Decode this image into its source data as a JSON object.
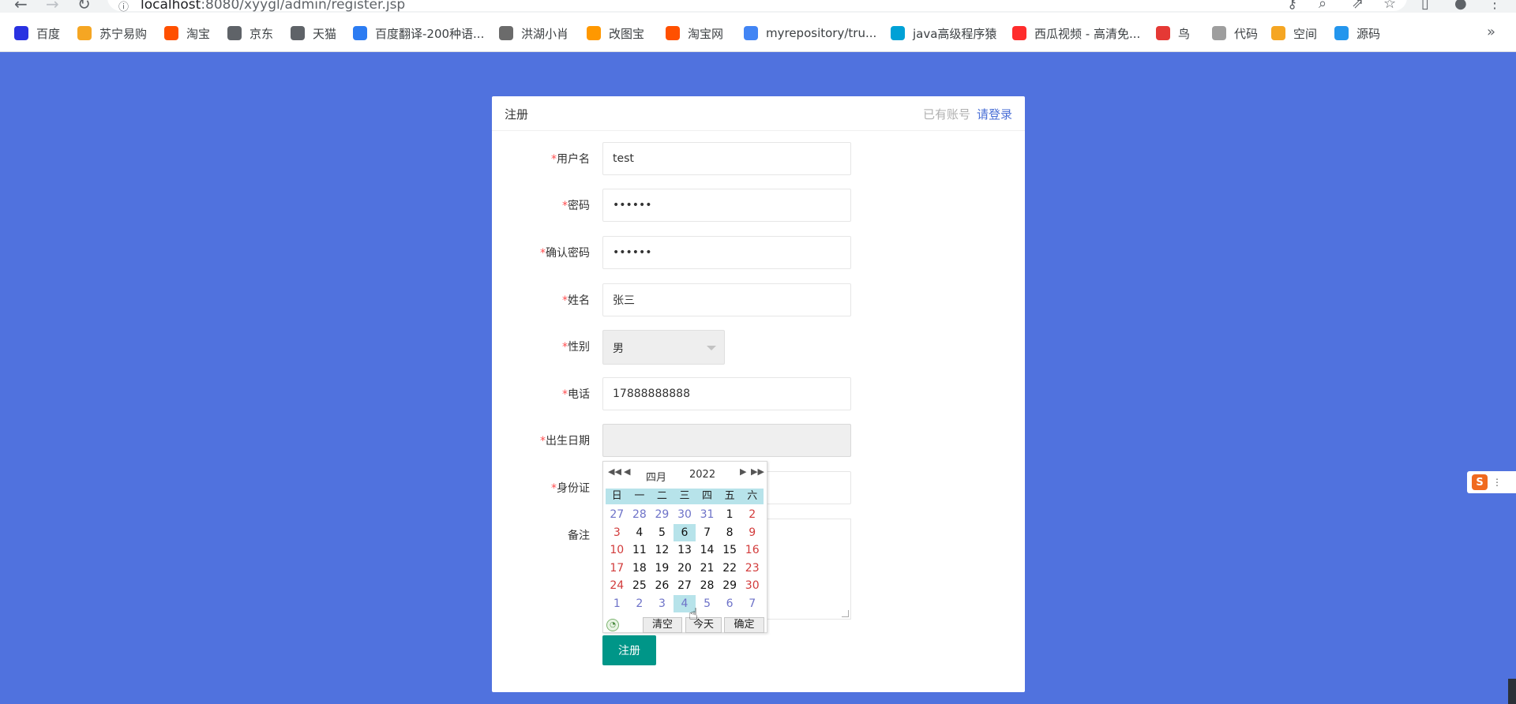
{
  "browser": {
    "url_host": "localhost",
    "url_path": ":8080/xyygl/admin/register.jsp",
    "bookmarks": [
      {
        "label": "百度",
        "icon": "baidu-paw-icon",
        "color": "#2932e1"
      },
      {
        "label": "苏宁易购",
        "icon": "suning-lion-icon",
        "color": "#f5a623"
      },
      {
        "label": "淘宝",
        "icon": "taobao-icon",
        "color": "#ff5000"
      },
      {
        "label": "京东",
        "icon": "globe-icon",
        "color": "#5f6368"
      },
      {
        "label": "天猫",
        "icon": "globe-icon",
        "color": "#5f6368"
      },
      {
        "label": "百度翻译-200种语...",
        "icon": "translate-icon",
        "color": "#2c7cf2"
      },
      {
        "label": "洪湖小肖",
        "icon": "bird-icon",
        "color": "#6b6b6b"
      },
      {
        "label": "改图宝",
        "icon": "gaitubao-icon",
        "color": "#ff9800"
      },
      {
        "label": "淘宝网",
        "icon": "taobao-icon",
        "color": "#ff5000"
      },
      {
        "label": "myrepository/tru...",
        "icon": "chrome-icon",
        "color": "#4285f4"
      },
      {
        "label": "java高级程序猿",
        "icon": "bilibili-icon",
        "color": "#00a1d6"
      },
      {
        "label": "西瓜视频 - 高清免...",
        "icon": "xigua-icon",
        "color": "#ff2d2d"
      },
      {
        "label": "鸟",
        "icon": "bird-red-icon",
        "color": "#e53935"
      },
      {
        "label": "代码",
        "icon": "code-icon",
        "color": "#9e9e9e"
      },
      {
        "label": "空间",
        "icon": "qzone-icon",
        "color": "#f5a623"
      },
      {
        "label": "源码",
        "icon": "docker-icon",
        "color": "#2496ed"
      }
    ],
    "more_label": "»"
  },
  "card": {
    "title": "注册",
    "has_account_text": "已有账号",
    "login_link": "请登录"
  },
  "form": {
    "required_mark": "*",
    "username": {
      "label": "用户名",
      "value": "test"
    },
    "password": {
      "label": "密码",
      "value": "••••••"
    },
    "confirm_password": {
      "label": "确认密码",
      "value": "••••••"
    },
    "name": {
      "label": "姓名",
      "value": "张三"
    },
    "gender": {
      "label": "性别",
      "value": "男"
    },
    "phone": {
      "label": "电话",
      "value": "17888888888"
    },
    "birthday": {
      "label": "出生日期",
      "value": ""
    },
    "id_card": {
      "label": "身份证",
      "value": ""
    },
    "remark": {
      "label": "备注",
      "value": ""
    },
    "submit_label": "注册"
  },
  "datepicker": {
    "month": "四月",
    "year": "2022",
    "weekdays": [
      "日",
      "一",
      "二",
      "三",
      "四",
      "五",
      "六"
    ],
    "days": [
      [
        "27",
        "28",
        "29",
        "30",
        "31",
        "1",
        "2"
      ],
      [
        "3",
        "4",
        "5",
        "6",
        "7",
        "8",
        "9"
      ],
      [
        "10",
        "11",
        "12",
        "13",
        "14",
        "15",
        "16"
      ],
      [
        "17",
        "18",
        "19",
        "20",
        "21",
        "22",
        "23"
      ],
      [
        "24",
        "25",
        "26",
        "27",
        "28",
        "29",
        "30"
      ],
      [
        "1",
        "2",
        "3",
        "4",
        "5",
        "6",
        "7"
      ]
    ],
    "today": "6",
    "hovered": "4",
    "buttons": {
      "clear": "清空",
      "today": "今天",
      "ok": "确定"
    }
  }
}
